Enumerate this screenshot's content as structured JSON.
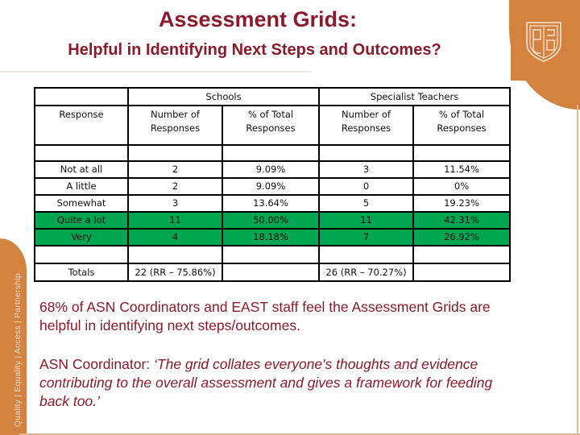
{
  "header": {
    "title": "Assessment Grids:",
    "subtitle": "Helpful in Identifying Next Steps and Outcomes?"
  },
  "branding": {
    "logo_icon": "shield-crest-icon",
    "tagline": "Quality | Equality | Access | Partnership",
    "accent_color": "#d4823f",
    "text_color": "#8b1a2b"
  },
  "table": {
    "group_headers": {
      "schools": "Schools",
      "specialist": "Specialist Teachers"
    },
    "column_headers": {
      "response": "Response",
      "schools_number": "Number of Responses",
      "schools_percent": "% of Total Responses",
      "specialist_number": "Number of Responses",
      "specialist_percent": "% of Total Responses"
    },
    "rows": [
      {
        "response": "Not at all",
        "schools_number": "2",
        "schools_percent": "9.09%",
        "specialist_number": "3",
        "specialist_percent": "11.54%",
        "highlight": false
      },
      {
        "response": "A little",
        "schools_number": "2",
        "schools_percent": "9.09%",
        "specialist_number": "0",
        "specialist_percent": "0%",
        "highlight": false
      },
      {
        "response": "Somewhat",
        "schools_number": "3",
        "schools_percent": "13.64%",
        "specialist_number": "5",
        "specialist_percent": "19.23%",
        "highlight": false
      },
      {
        "response": "Quite a lot",
        "schools_number": "11",
        "schools_percent": "50.00%",
        "specialist_number": "11",
        "specialist_percent": "42.31%",
        "highlight": true
      },
      {
        "response": "Very",
        "schools_number": "4",
        "schools_percent": "18.18%",
        "specialist_number": "7",
        "specialist_percent": "26.92%",
        "highlight": true
      }
    ],
    "totals": {
      "label": "Totals",
      "schools": "22 (RR – 75.86%)",
      "specialist": "26 (RR – 70.27%)"
    },
    "highlight_color": "#00a651"
  },
  "body": {
    "stat_text": "68% of ASN Coordinators and EAST staff feel the Assessment Grids are helpful in identifying next steps/outcomes.",
    "quote_attribution": "ASN Coordinator: ",
    "quote_text": "‘The grid collates everyone's thoughts and evidence contributing to the overall assessment and gives a framework for feeding back too.’"
  }
}
